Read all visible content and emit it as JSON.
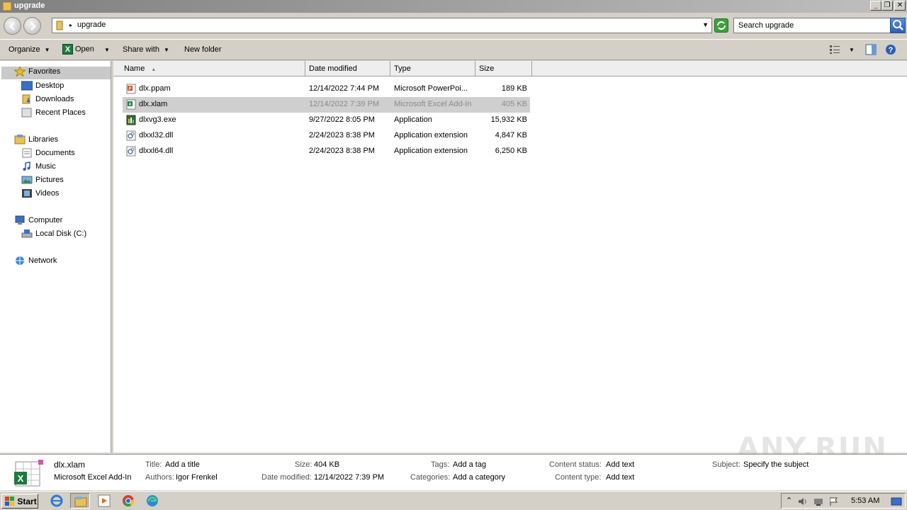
{
  "window": {
    "title": "upgrade",
    "buttons": {
      "minimize": "_",
      "maximize": "❐",
      "close": "✕"
    }
  },
  "address": {
    "path": "upgrade",
    "search_placeholder": "Search upgrade"
  },
  "toolbar": {
    "organize": "Organize",
    "open": "Open",
    "share_with": "Share with",
    "new_folder": "New folder"
  },
  "nav": {
    "favorites": "Favorites",
    "desktop": "Desktop",
    "downloads": "Downloads",
    "recent_places": "Recent Places",
    "libraries": "Libraries",
    "documents": "Documents",
    "music": "Music",
    "pictures": "Pictures",
    "videos": "Videos",
    "computer": "Computer",
    "local_disk": "Local Disk (C:)",
    "network": "Network"
  },
  "columns": {
    "name": "Name",
    "date": "Date modified",
    "type": "Type",
    "size": "Size"
  },
  "files": [
    {
      "name": "dlx.ppam",
      "date": "12/14/2022 7:44 PM",
      "type": "Microsoft PowerPoi...",
      "size": "189 KB",
      "icon": "powerpoint-addin-icon"
    },
    {
      "name": "dlx.xlam",
      "date": "12/14/2022 7:39 PM",
      "type": "Microsoft Excel Add-In",
      "size": "405 KB",
      "icon": "excel-addin-icon"
    },
    {
      "name": "dlxvg3.exe",
      "date": "9/27/2022 8:05 PM",
      "type": "Application",
      "size": "15,932 KB",
      "icon": "application-icon"
    },
    {
      "name": "dlxxl32.dll",
      "date": "2/24/2023 8:38 PM",
      "type": "Application extension",
      "size": "4,847 KB",
      "icon": "dll-icon"
    },
    {
      "name": "dlxxl64.dll",
      "date": "2/24/2023 8:38 PM",
      "type": "Application extension",
      "size": "6,250 KB",
      "icon": "dll-icon"
    }
  ],
  "details": {
    "filename": "dlx.xlam",
    "filetype": "Microsoft Excel Add-In",
    "authors_label": "Authors:",
    "authors_value": "Igor Frenkel",
    "title_label": "Title:",
    "title_value": "Add a title",
    "size_label": "Size:",
    "size_value": "404 KB",
    "modified_label": "Date modified:",
    "modified_value": "12/14/2022 7:39 PM",
    "tags_label": "Tags:",
    "tags_value": "Add a tag",
    "categories_label": "Categories:",
    "categories_value": "Add a category",
    "content_status_label": "Content status:",
    "content_status_value": "Add text",
    "content_type_label": "Content type:",
    "content_type_value": "Add text",
    "subject_label": "Subject:",
    "subject_value": "Specify the subject"
  },
  "watermark": "ANY.RUN",
  "taskbar": {
    "start": "Start",
    "clock": "5:53 AM"
  }
}
